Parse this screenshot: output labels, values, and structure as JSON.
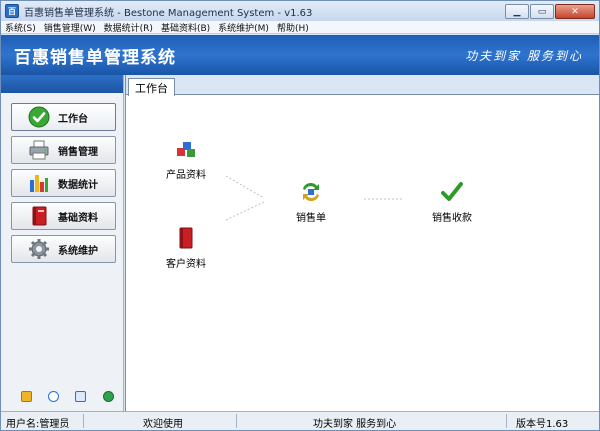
{
  "window": {
    "title": "百惠销售单管理系统 - Bestone Management System - v1.63",
    "app_icon_glyph": "百"
  },
  "menu": [
    "系统(S)",
    "销售管理(W)",
    "数据统计(R)",
    "基础资料(B)",
    "系统维护(M)",
    "帮助(H)"
  ],
  "banner": {
    "title": "百惠销售单管理系统",
    "slogan": "功夫到家 服务到心"
  },
  "sidebar": {
    "items": [
      {
        "label": "工作台",
        "icon": "check-icon"
      },
      {
        "label": "销售管理",
        "icon": "printer-icon"
      },
      {
        "label": "数据统计",
        "icon": "bar-chart-icon"
      },
      {
        "label": "基础资料",
        "icon": "book-icon"
      },
      {
        "label": "系统维护",
        "icon": "gear-icon"
      }
    ],
    "tools": [
      "note-icon",
      "clock-icon",
      "search-icon",
      "globe-icon"
    ]
  },
  "content": {
    "tab_label": "工作台",
    "nodes": {
      "product": "产品资料",
      "customer": "客户资料",
      "sales_order": "销售单",
      "payment": "销售收款"
    }
  },
  "status": {
    "user": "用户名:管理员",
    "welcome": "欢迎使用",
    "slogan": "功夫到家 服务到心",
    "version": "版本号1.63"
  },
  "colors": {
    "banner": "#2e74cf",
    "check_green": "#2e9a2a",
    "book_red": "#c81e24"
  }
}
